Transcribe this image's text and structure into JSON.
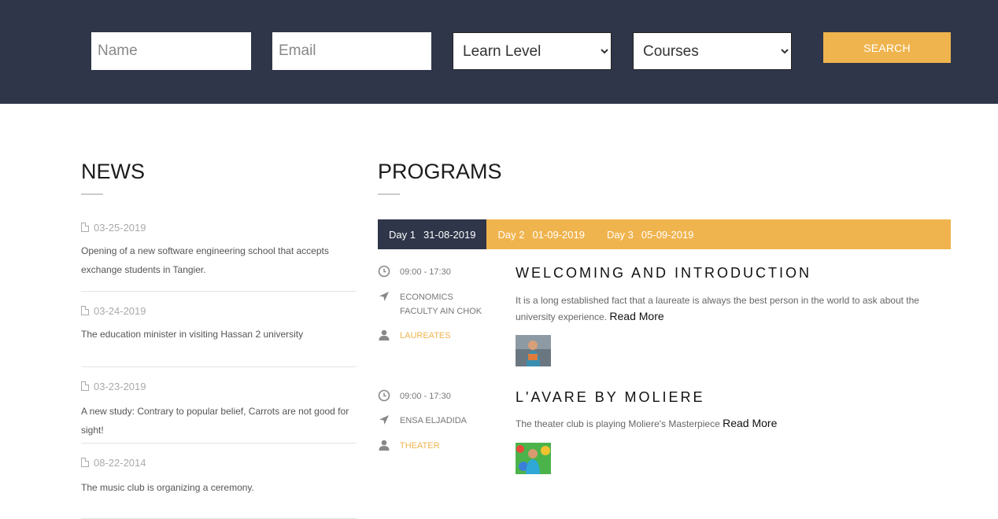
{
  "search_bar": {
    "name_placeholder": "Name",
    "email_placeholder": "Email",
    "level_selected": "Learn Level",
    "courses_selected": "Courses",
    "search_label": "SEARCH"
  },
  "news": {
    "heading": "NEWS",
    "items": [
      {
        "date": "03-25-2019",
        "text": "Opening of a new software engineering school that accepts exchange students in Tangier."
      },
      {
        "date": "03-24-2019",
        "text": "The education minister in visiting Hassan 2 university"
      },
      {
        "date": "03-23-2019",
        "text": "A new study: Contrary to popular belief, Carrots are not good for sight!"
      },
      {
        "date": "08-22-2014",
        "text": "The music club is organizing a ceremony."
      }
    ]
  },
  "programs": {
    "heading": "PROGRAMS",
    "tabs": [
      {
        "day": "Day 1",
        "date": "31-08-2019"
      },
      {
        "day": "Day 2",
        "date": "01-09-2019"
      },
      {
        "day": "Day 3",
        "date": "05-09-2019"
      }
    ],
    "items": [
      {
        "time": "09:00 - 17:30",
        "location": "ECONOMICS FACULTY AIN CHOK",
        "audience": "LAUREATES",
        "title": "WELCOMING AND INTRODUCTION",
        "description": "It is a long established fact that a laureate is always the best person in the world to ask about the university experience.",
        "read_more": "Read More"
      },
      {
        "time": "09:00 - 17:30",
        "location": "ENSA ELJADIDA",
        "audience": "THEATER",
        "title": "L'AVARE BY MOLIERE",
        "description": "The theater club is playing Moliere's Masterpiece",
        "read_more": "Read More"
      }
    ]
  },
  "colors": {
    "navy": "#2f364a",
    "accent": "#f0b44e"
  }
}
